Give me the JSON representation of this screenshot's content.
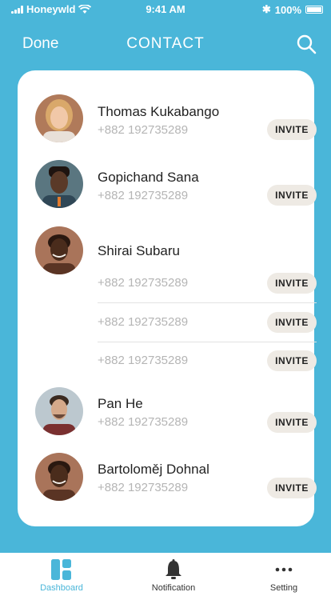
{
  "status_bar": {
    "carrier": "Honeywld",
    "time": "9:41 AM",
    "battery": "100%"
  },
  "nav": {
    "left_button": "Done",
    "title": "CONTACT",
    "search_icon": "search-icon"
  },
  "contacts": [
    {
      "name": "Thomas Kukabango",
      "phones": [
        "+882 192735289"
      ],
      "invite_label": "INVITE",
      "avatar_colors": {
        "bg": "#b07a5a",
        "face": "#f1c8a8",
        "hair": "#d9a86a",
        "shirt": "#e8e0d8"
      }
    },
    {
      "name": "Gopichand Sana",
      "phones": [
        "+882 192735289"
      ],
      "invite_label": "INVITE",
      "avatar_colors": {
        "bg": "#5a7680",
        "face": "#5a3a28",
        "hair": "#1e1410",
        "shirt": "#2f4756"
      }
    },
    {
      "name": "Shirai Subaru",
      "phones": [
        "+882 192735289",
        "+882 192735289",
        "+882 192735289"
      ],
      "invite_label": "INVITE",
      "avatar_colors": {
        "bg": "#a9745a",
        "face": "#4a2c1c",
        "hair": "#2a1810",
        "shirt": "#5a3424"
      }
    },
    {
      "name": "Pan He",
      "phones": [
        "+882 192735289"
      ],
      "invite_label": "INVITE",
      "avatar_colors": {
        "bg": "#bcc8cf",
        "face": "#d5a98a",
        "hair": "#3a2a20",
        "shirt": "#7a3030"
      }
    },
    {
      "name": "Bartoloměj Dohnal",
      "phones": [
        "+882 192735289"
      ],
      "invite_label": "INVITE",
      "avatar_colors": {
        "bg": "#a9745a",
        "face": "#4a2c1c",
        "hair": "#2a1810",
        "shirt": "#5a3424"
      }
    }
  ],
  "tabs": [
    {
      "label": "Dashboard",
      "icon": "dashboard-icon",
      "active": true
    },
    {
      "label": "Notification",
      "icon": "bell-icon",
      "active": false
    },
    {
      "label": "Setting",
      "icon": "more-icon",
      "active": false
    }
  ],
  "colors": {
    "accent": "#4ab6d9",
    "invite_bg": "#eeeae4",
    "muted_text": "#b5b5b5"
  }
}
